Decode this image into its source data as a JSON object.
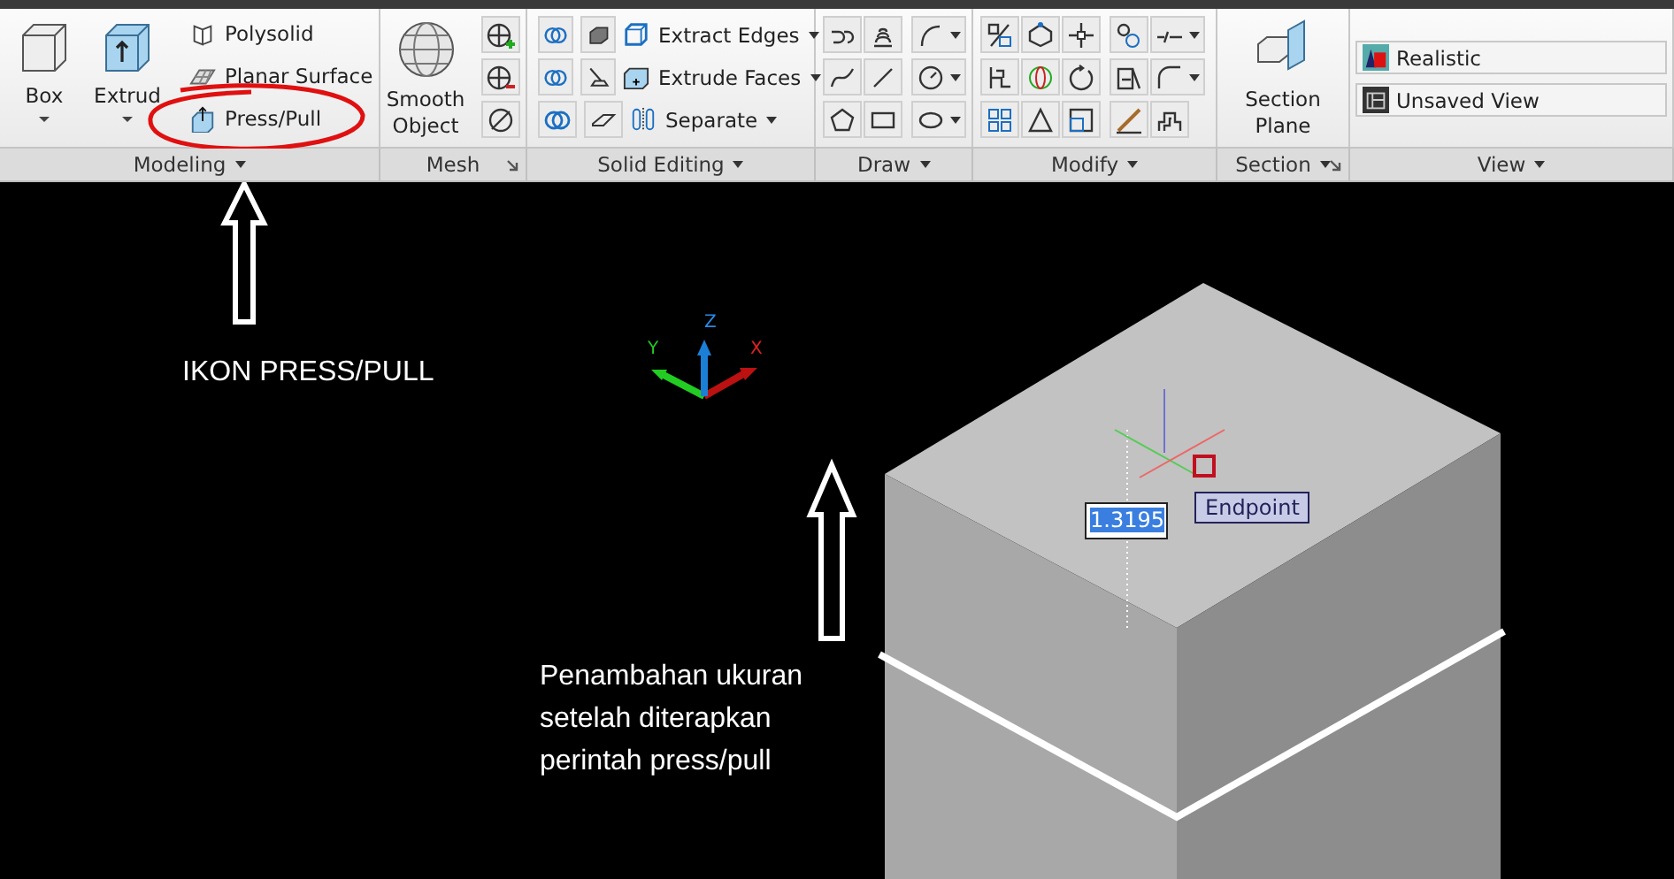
{
  "ribbon": {
    "panels": [
      {
        "title": "Modeling",
        "has_menu": true,
        "has_launcher": false
      },
      {
        "title": "Mesh",
        "has_menu": false,
        "has_launcher": true
      },
      {
        "title": "Solid Editing",
        "has_menu": true,
        "has_launcher": false
      },
      {
        "title": "Draw",
        "has_menu": true,
        "has_launcher": false
      },
      {
        "title": "Modify",
        "has_menu": true,
        "has_launcher": false
      },
      {
        "title": "Section",
        "has_menu": true,
        "has_launcher": true
      },
      {
        "title": "View",
        "has_menu": true,
        "has_launcher": false
      }
    ],
    "modeling": {
      "large": [
        {
          "label": "Box"
        },
        {
          "label": "Extrud"
        }
      ],
      "small": [
        {
          "label": "Polysolid",
          "circled": false
        },
        {
          "label": "Planar Surface",
          "circled": false
        },
        {
          "label": "Press/Pull",
          "circled": true
        }
      ]
    },
    "mesh": {
      "large": {
        "label_lines": [
          "Smooth",
          "Object"
        ]
      }
    },
    "solid_editing": {
      "items": [
        {
          "label": "Extract Edges"
        },
        {
          "label": "Extrude Faces"
        },
        {
          "label": "Separate"
        }
      ]
    },
    "section": {
      "large": {
        "label_lines": [
          "Section",
          "Plane"
        ]
      }
    },
    "view": {
      "items": [
        {
          "label": "Realistic"
        },
        {
          "label": "Unsaved View"
        }
      ]
    }
  },
  "viewport": {
    "axes": {
      "x": "X",
      "y": "Y",
      "z": "Z"
    },
    "dynamic_input": "1.3195",
    "snap_tooltip": "Endpoint",
    "annotations": [
      {
        "text": "IKON PRESS/PULL"
      },
      {
        "text": "Penambahan ukuran\nsetelah diterapkan\nperintah press/pull"
      }
    ]
  }
}
